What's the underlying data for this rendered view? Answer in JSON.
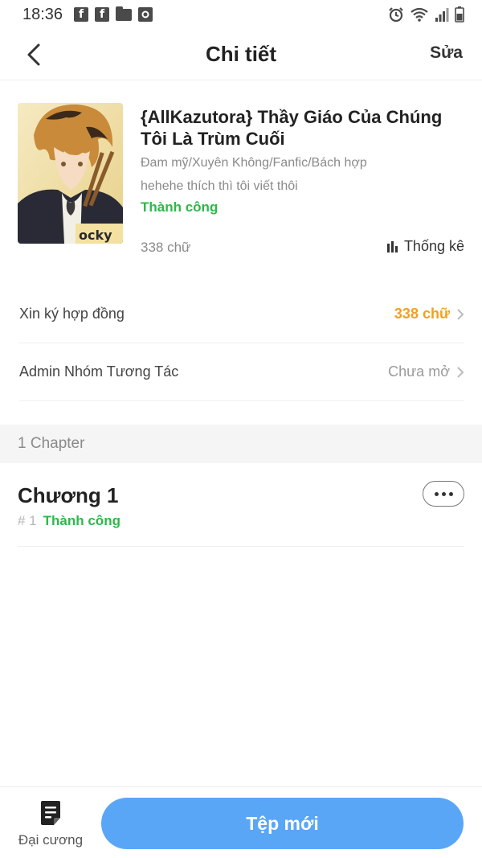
{
  "status_bar": {
    "time": "18:36",
    "left_icons": [
      "facebook-icon",
      "facebook-icon",
      "folder-icon",
      "camera-icon"
    ],
    "right_icons": [
      "alarm-icon",
      "wifi-icon",
      "signal-icon",
      "battery-icon"
    ]
  },
  "header": {
    "title": "Chi tiết",
    "edit_label": "Sửa",
    "back_icon": "chevron-left-icon"
  },
  "book": {
    "title": "{AllKazutora} Thầy Giáo Của Chúng Tôi Là Trùm Cuối",
    "genres": "Đam mỹ/Xuyên Không/Fanfic/Bách hợp",
    "description": "hehehe thích thì tôi viết thôi",
    "status": "Thành công",
    "word_count": "338 chữ",
    "stats_label": "Thống kê",
    "stats_icon": "bar-chart-icon",
    "cover_text": "ocky"
  },
  "rows": [
    {
      "label": "Xin ký hợp đồng",
      "value": "338 chữ",
      "value_color": "#f0a21c"
    },
    {
      "label": "Admin Nhóm Tương Tác",
      "value": "Chưa mở",
      "value_color": "#9a9a9a"
    }
  ],
  "section": {
    "label": "1 Chapter"
  },
  "chapters": [
    {
      "title": "Chương 1",
      "number": "# 1",
      "status": "Thành công"
    }
  ],
  "bottom_bar": {
    "outline_label": "Đại cương",
    "outline_icon": "document-icon",
    "new_file_label": "Tệp mới"
  },
  "colors": {
    "accent_blue": "#5aa6f6",
    "success_green": "#2db84a",
    "warning_orange": "#f0a21c"
  }
}
